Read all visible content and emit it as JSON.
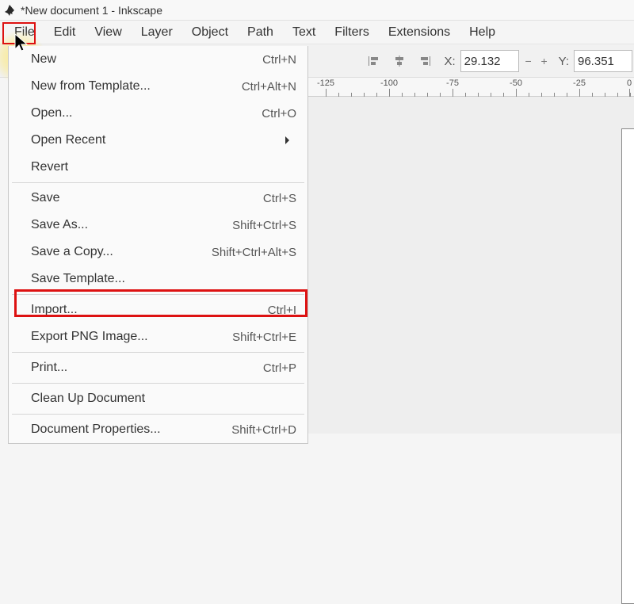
{
  "window": {
    "title": "*New document 1 - Inkscape"
  },
  "menubar": {
    "items": [
      "File",
      "Edit",
      "View",
      "Layer",
      "Object",
      "Path",
      "Text",
      "Filters",
      "Extensions",
      "Help"
    ]
  },
  "toolbar": {
    "x_label": "X:",
    "y_label": "Y:",
    "x_value": "29.132",
    "y_value": "96.351"
  },
  "ruler": {
    "marks": [
      {
        "pos": 22,
        "label": "-125"
      },
      {
        "pos": 102,
        "label": "-100"
      },
      {
        "pos": 182,
        "label": "-75"
      },
      {
        "pos": 262,
        "label": "-50"
      },
      {
        "pos": 342,
        "label": "-25"
      },
      {
        "pos": 405,
        "label": "0"
      }
    ]
  },
  "file_menu": {
    "items": [
      {
        "label": "New",
        "accel": "Ctrl+N",
        "sep": false
      },
      {
        "label": "New from Template...",
        "accel": "Ctrl+Alt+N",
        "sep": false
      },
      {
        "label": "Open...",
        "accel": "Ctrl+O",
        "sep": false
      },
      {
        "label": "Open Recent",
        "accel": "",
        "sep": false,
        "submenu": true
      },
      {
        "label": "Revert",
        "accel": "",
        "sep": true
      },
      {
        "label": "Save",
        "accel": "Ctrl+S",
        "sep": false
      },
      {
        "label": "Save As...",
        "accel": "Shift+Ctrl+S",
        "sep": false
      },
      {
        "label": "Save a Copy...",
        "accel": "Shift+Ctrl+Alt+S",
        "sep": false
      },
      {
        "label": "Save Template...",
        "accel": "",
        "sep": true
      },
      {
        "label": "Import...",
        "accel": "Ctrl+I",
        "sep": false
      },
      {
        "label": "Export PNG Image...",
        "accel": "Shift+Ctrl+E",
        "sep": true
      },
      {
        "label": "Print...",
        "accel": "Ctrl+P",
        "sep": true
      },
      {
        "label": "Clean Up Document",
        "accel": "",
        "sep": true
      },
      {
        "label": "Document Properties...",
        "accel": "Shift+Ctrl+D",
        "sep": false
      }
    ]
  },
  "highlights": {
    "file_menu_item": true,
    "import_item": true
  }
}
